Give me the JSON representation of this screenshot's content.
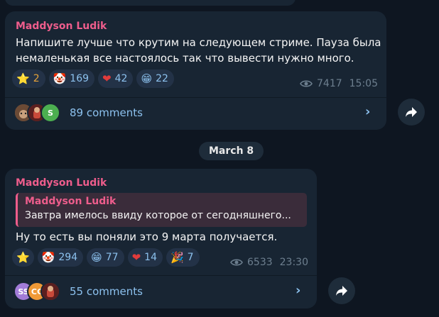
{
  "messages": [
    {
      "author": "Maddyson Ludik",
      "text_lines": [
        "Напишите лучше что крутим на следующем стриме. Пауза была",
        "немаленькая все настоялось так что вывести нужно много."
      ],
      "reactions": [
        {
          "emoji": "⭐",
          "count": "2"
        },
        {
          "emoji": "🤡",
          "count": "169"
        },
        {
          "emoji": "❤",
          "count": "42"
        },
        {
          "emoji": "😁",
          "count": "22"
        }
      ],
      "views": "7417",
      "time": "15:05",
      "comments": "89 comments"
    },
    {
      "author": "Maddyson Ludik",
      "quote_author": "Maddyson Ludik",
      "quote_text": "Завтра имелось ввиду которое от сегодняшнего...",
      "text_lines": [
        "Ну то есть вы поняли это 9 марта получается."
      ],
      "reactions": [
        {
          "emoji": "⭐",
          "count": ""
        },
        {
          "emoji": "🤡",
          "count": "294"
        },
        {
          "emoji": "😁",
          "count": "77"
        },
        {
          "emoji": "❤",
          "count": "14"
        },
        {
          "emoji": "🎉",
          "count": "7"
        }
      ],
      "views": "6533",
      "time": "23:30",
      "comments": "55 comments",
      "avatar_initials": [
        "SS",
        "CC"
      ]
    }
  ],
  "avatar_s": "S",
  "date_separator": "March 8",
  "colors": {
    "background": "#0e1621",
    "bubble": "#182533",
    "author": "#ee5d8c",
    "link": "#8cc1ee",
    "meta": "#6d7f8f"
  }
}
